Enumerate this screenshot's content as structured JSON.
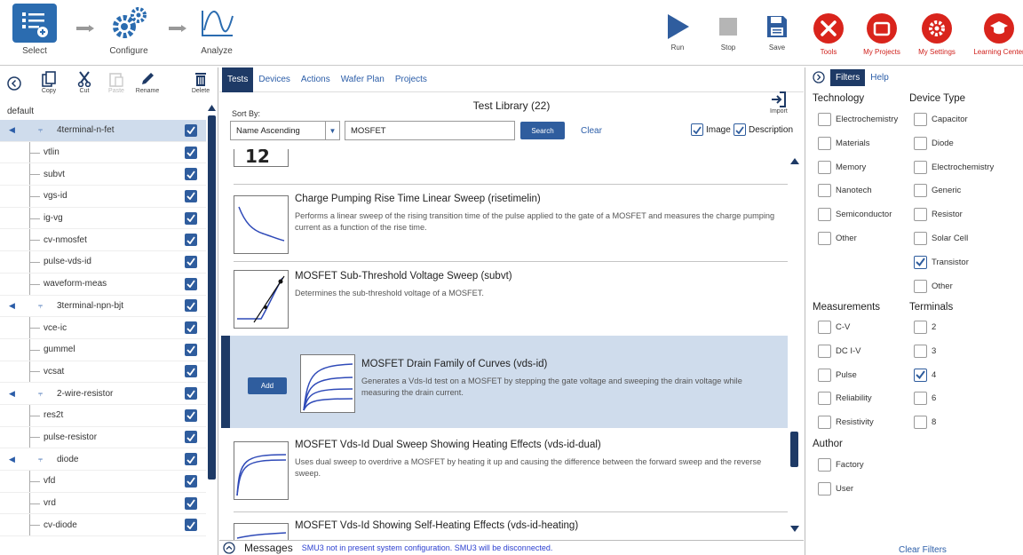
{
  "toolbar": {
    "workflow": [
      {
        "label": "Select"
      },
      {
        "label": "Configure"
      },
      {
        "label": "Analyze"
      }
    ],
    "run_label": "Run",
    "stop_label": "Stop",
    "save_label": "Save",
    "tools_label": "Tools",
    "projects_label": "My Projects",
    "settings_label": "My Settings",
    "learning_label": "Learning Center"
  },
  "left": {
    "copy": "Copy",
    "cut": "Cut",
    "paste": "Paste",
    "rename": "Rename",
    "delete": "Delete",
    "root": "default",
    "tree": [
      {
        "type": "device",
        "label": "4terminal-n-fet",
        "selected": true
      },
      {
        "type": "test",
        "label": "vtlin"
      },
      {
        "type": "test",
        "label": "subvt"
      },
      {
        "type": "test",
        "label": "vgs-id"
      },
      {
        "type": "test",
        "label": "ig-vg"
      },
      {
        "type": "test",
        "label": "cv-nmosfet"
      },
      {
        "type": "test",
        "label": "pulse-vds-id"
      },
      {
        "type": "test",
        "label": "waveform-meas"
      },
      {
        "type": "device",
        "label": "3terminal-npn-bjt"
      },
      {
        "type": "test",
        "label": "vce-ic"
      },
      {
        "type": "test",
        "label": "gummel"
      },
      {
        "type": "test",
        "label": "vcsat"
      },
      {
        "type": "device",
        "label": "2-wire-resistor"
      },
      {
        "type": "test",
        "label": "res2t"
      },
      {
        "type": "test",
        "label": "pulse-resistor"
      },
      {
        "type": "device",
        "label": "diode"
      },
      {
        "type": "test",
        "label": "vfd"
      },
      {
        "type": "test",
        "label": "vrd"
      },
      {
        "type": "test",
        "label": "cv-diode"
      }
    ]
  },
  "center": {
    "tabs": [
      "Tests",
      "Devices",
      "Actions",
      "Wafer Plan",
      "Projects"
    ],
    "title": "Test Library (22)",
    "import_label": "Import",
    "sort_label": "Sort By:",
    "sort_value": "Name Ascending",
    "search_value": "MOSFET",
    "search_btn": "Search",
    "clear_btn": "Clear",
    "image_label": "Image",
    "description_label": "Description",
    "add_label": "Add",
    "tests": [
      {
        "title": "Charge Pumping Rise Time Linear Sweep (risetimelin)",
        "desc": "Performs a linear sweep of the rising transition time of the pulse applied to the gate of a MOSFET and measures the charge pumping current as a function of the rise time."
      },
      {
        "title": "MOSFET Sub-Threshold Voltage Sweep (subvt)",
        "desc": "Determines the sub-threshold voltage of a MOSFET."
      },
      {
        "title": "MOSFET Drain Family of Curves (vds-id)",
        "desc": "Generates a Vds-Id test on a MOSFET by stepping the gate voltage and sweeping the drain voltage while measuring the drain current."
      },
      {
        "title": "MOSFET Vds-Id Dual Sweep Showing Heating Effects (vds-id-dual)",
        "desc": "Uses dual sweep to overdrive a MOSFET by heating it up and causing the difference between the forward sweep and the reverse sweep."
      },
      {
        "title": "MOSFET Vds-Id Showing Self-Heating Effects (vds-id-heating)",
        "desc": ""
      }
    ],
    "messages_title": "Messages",
    "messages_text": "SMU3 not in present system configuration. SMU3 will be disconnected."
  },
  "right": {
    "tabs": [
      "Filters",
      "Help"
    ],
    "technology_head": "Technology",
    "device_type_head": "Device Type",
    "technology": [
      "Electrochemistry",
      "Materials",
      "Memory",
      "Nanotech",
      "Semiconductor",
      "Other"
    ],
    "device_type": [
      "Capacitor",
      "Diode",
      "Electrochemistry",
      "Generic",
      "Resistor",
      "Solar Cell",
      "Transistor",
      "Other"
    ],
    "measurements_head": "Measurements",
    "terminals_head": "Terminals",
    "measurements": [
      "C-V",
      "DC I-V",
      "Pulse",
      "Reliability",
      "Resistivity"
    ],
    "terminals": [
      "2",
      "3",
      "4",
      "6",
      "8"
    ],
    "author_head": "Author",
    "author": [
      "Factory",
      "User"
    ],
    "clear_filters": "Clear Filters"
  },
  "colors": {
    "accent": "#2f5d9e",
    "dark_accent": "#1e3a66",
    "selection": "#cfdcec",
    "brand_red": "#d9241c"
  }
}
